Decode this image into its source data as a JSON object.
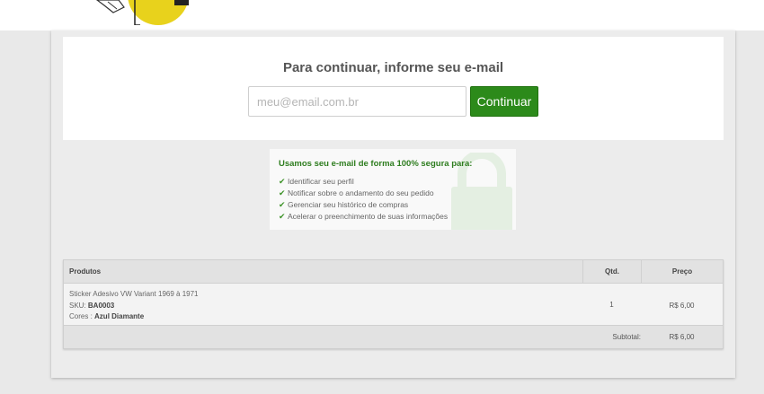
{
  "header": {
    "logo_icon": "store-logo-icon"
  },
  "email_panel": {
    "title": "Para continuar, informe seu e-mail",
    "input_placeholder": "meu@email.com.br",
    "input_value": "",
    "continue_label": "Continuar"
  },
  "security": {
    "title": "Usamos seu e-mail de forma 100% segura para:",
    "items": [
      "Identificar seu perfil",
      "Notificar sobre o andamento do seu pedido",
      "Gerenciar seu histórico de compras",
      "Acelerar o preenchimento de suas informações"
    ],
    "icon": "lock-icon",
    "check_icon": "check-icon"
  },
  "cart": {
    "headers": {
      "product": "Produtos",
      "qty": "Qtd.",
      "price": "Preço"
    },
    "items": [
      {
        "name": "Sticker Adesivo VW Variant 1969 à 1971",
        "sku_label": "SKU:",
        "sku": "BA0003",
        "colors_label": "Cores :",
        "colors": "Azul Diamante",
        "qty": "1",
        "price": "R$ 6,00"
      }
    ],
    "subtotal_label": "Subtotal:",
    "subtotal_value": "R$ 6,00"
  },
  "colors": {
    "button_green": "#2c8a1a",
    "security_title_green": "#2e7d1f"
  }
}
